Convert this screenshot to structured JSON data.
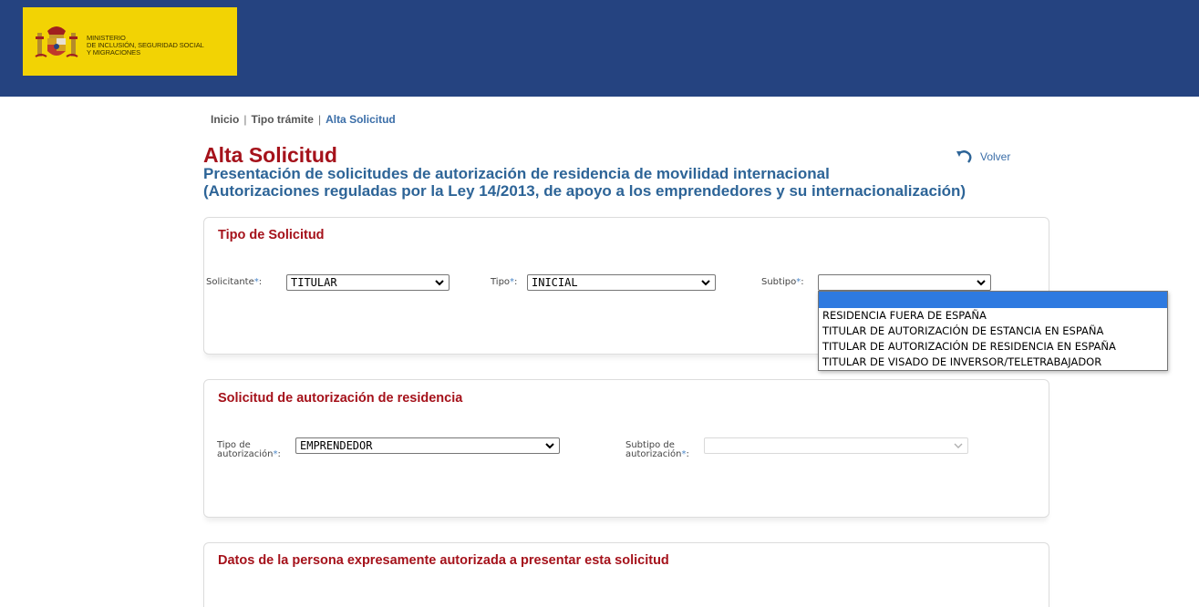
{
  "header": {
    "ministry_line1": "MINISTERIO",
    "ministry_line2": "DE INCLUSIÓN, SEGURIDAD SOCIAL",
    "ministry_line3": "Y MIGRACIONES",
    "bg_color": "#254380",
    "logo_bg_color": "#f2d304"
  },
  "breadcrumb": {
    "items": [
      "Inicio",
      "Tipo trámite",
      "Alta Solicitud"
    ]
  },
  "page": {
    "title": "Alta Solicitud",
    "subtitle_line1": "Presentación de solicitudes de autorización de residencia de movilidad internacional",
    "subtitle_line2": "(Autorizaciones reguladas por la Ley 14/2013, de apoyo a los emprendedores y su internacionalización)",
    "back_label": "Volver"
  },
  "tipo_solicitud": {
    "heading": "Tipo de Solicitud",
    "solicitante": {
      "label": "Solicitante",
      "required_mark": "*",
      "colon": ":",
      "value": "TITULAR"
    },
    "tipo": {
      "label": "Tipo",
      "required_mark": "*",
      "colon": ":",
      "value": "INICIAL"
    },
    "subtipo": {
      "label": "Subtipo",
      "required_mark": "*",
      "colon": ":",
      "value": "",
      "options": [
        "",
        "RESIDENCIA FUERA DE ESPAÑA",
        "TITULAR DE AUTORIZACIÓN DE ESTANCIA EN ESPAÑA",
        "TITULAR DE AUTORIZACIÓN DE RESIDENCIA EN ESPAÑA",
        "TITULAR DE VISADO DE INVERSOR/TELETRABAJADOR"
      ]
    }
  },
  "solicitud_residencia": {
    "heading": "Solicitud de autorización de residencia",
    "tipo_autorizacion": {
      "label_line1": "Tipo de",
      "label_line2": "autorización",
      "required_mark": "*",
      "colon": ":",
      "value": "EMPRENDEDOR"
    },
    "subtipo_autorizacion": {
      "label_line1": "Subtipo de",
      "label_line2": "autorización",
      "required_mark": "*",
      "colon": ":",
      "value": ""
    }
  },
  "persona_autorizada": {
    "heading": "Datos de la persona expresamente autorizada a presentar esta solicitud"
  },
  "colors": {
    "title_red": "#a5121b",
    "subtitle_blue": "#2d6497",
    "dropdown_highlight": "#2e7ae0"
  }
}
